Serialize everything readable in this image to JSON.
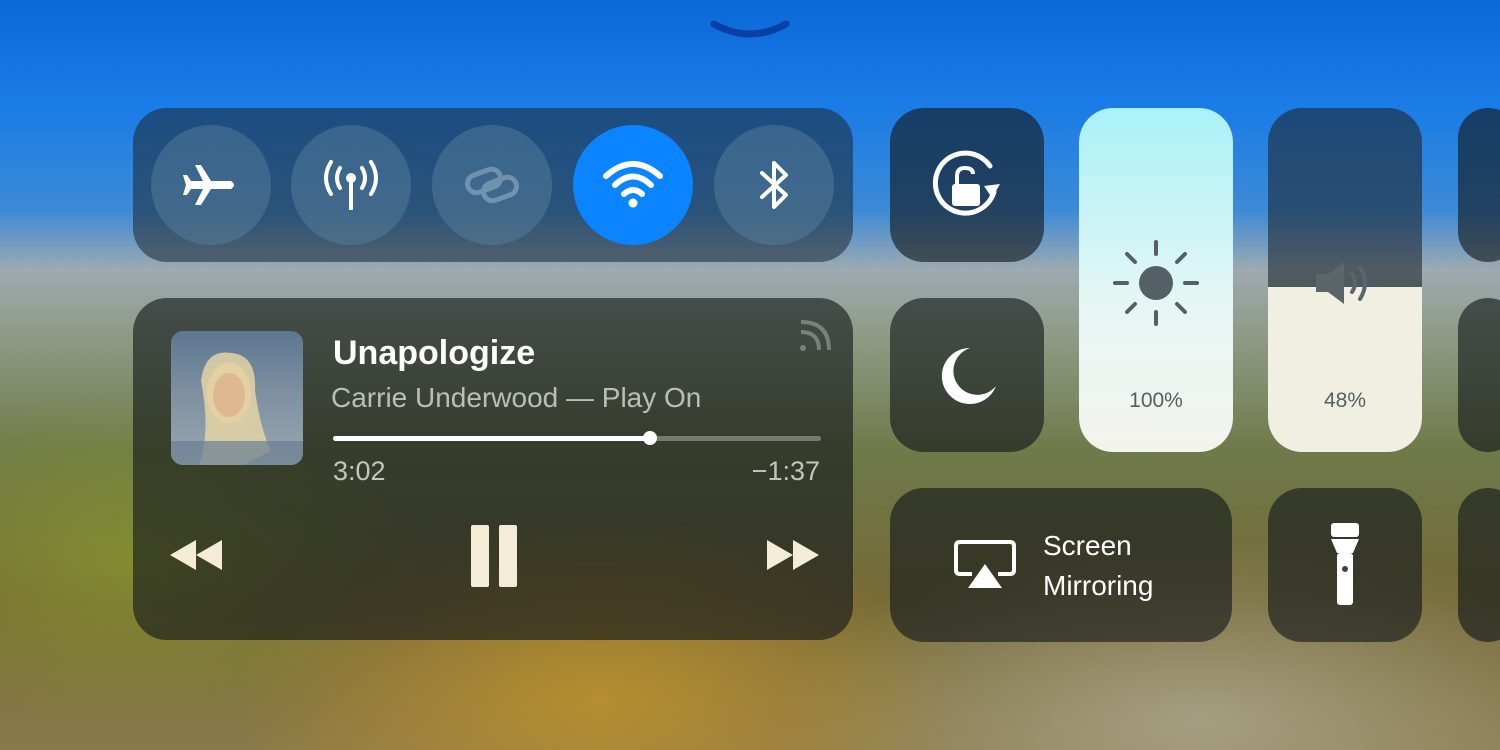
{
  "connectivity": {
    "buttons": [
      {
        "name": "airplane-mode",
        "icon": "airplane-icon",
        "active": false
      },
      {
        "name": "cellular-data",
        "icon": "antenna-icon",
        "active": false
      },
      {
        "name": "personal-hotspot",
        "icon": "link-icon",
        "active": false,
        "dimmed": true
      },
      {
        "name": "wifi",
        "icon": "wifi-icon",
        "active": true
      },
      {
        "name": "bluetooth",
        "icon": "bluetooth-icon",
        "active": false
      }
    ]
  },
  "now_playing": {
    "title": "Unapologize",
    "subtitle": "Carrie Underwood — Play On",
    "elapsed": "3:02",
    "remaining": "−1:37",
    "progress": 0.65
  },
  "brightness": {
    "label": "100%",
    "level": 1.0
  },
  "volume": {
    "label": "48%",
    "level": 0.48
  },
  "screen_mirroring": {
    "label_line1": "Screen",
    "label_line2": "Mirroring"
  },
  "colors": {
    "accent": "#0a84ff"
  }
}
